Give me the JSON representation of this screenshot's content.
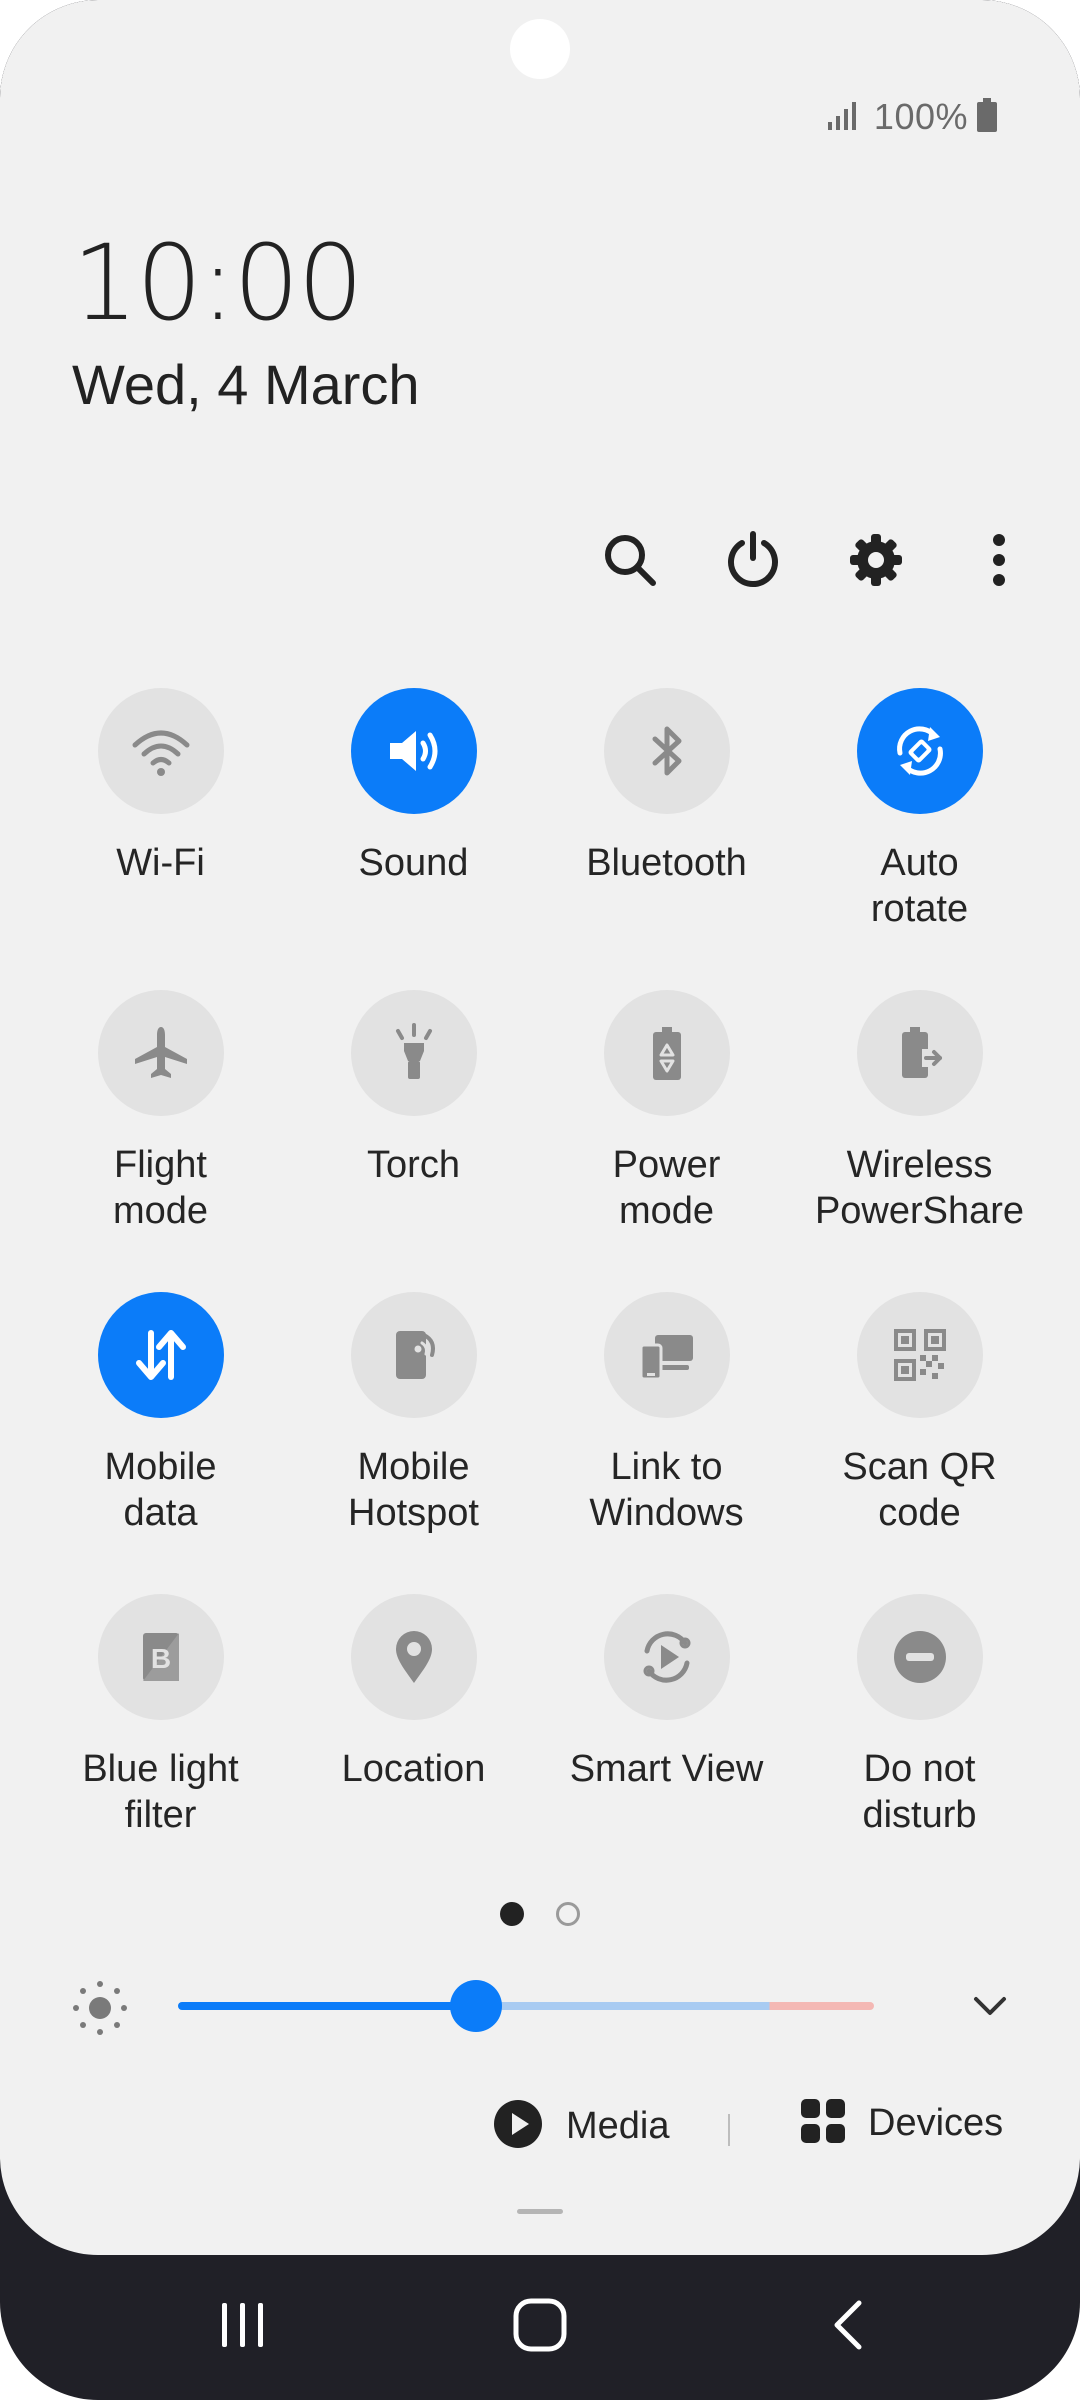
{
  "status": {
    "battery_text": "100%",
    "signal_icon": "signal-icon",
    "battery_icon": "battery-icon"
  },
  "clock": {
    "time": "10:00",
    "date": "Wed, 4 March"
  },
  "actions": [
    "search-icon",
    "power-icon",
    "settings-icon",
    "more-icon"
  ],
  "tiles": [
    {
      "label": "Wi-Fi",
      "icon": "wifi-icon",
      "on": false
    },
    {
      "label": "Sound",
      "icon": "sound-icon",
      "on": true
    },
    {
      "label": "Bluetooth",
      "icon": "bluetooth-icon",
      "on": false
    },
    {
      "label": "Auto\nrotate",
      "icon": "auto-rotate-icon",
      "on": true
    },
    {
      "label": "Flight\nmode",
      "icon": "airplane-icon",
      "on": false
    },
    {
      "label": "Torch",
      "icon": "torch-icon",
      "on": false
    },
    {
      "label": "Power\nmode",
      "icon": "power-mode-icon",
      "on": false
    },
    {
      "label": "Wireless\nPowerShare",
      "icon": "wireless-powershare-icon",
      "on": false
    },
    {
      "label": "Mobile\ndata",
      "icon": "mobile-data-icon",
      "on": true
    },
    {
      "label": "Mobile\nHotspot",
      "icon": "hotspot-icon",
      "on": false
    },
    {
      "label": "Link to\nWindows",
      "icon": "link-to-windows-icon",
      "on": false
    },
    {
      "label": "Scan QR\ncode",
      "icon": "qr-code-icon",
      "on": false
    },
    {
      "label": "Blue light\nfilter",
      "icon": "blue-light-filter-icon",
      "on": false
    },
    {
      "label": "Location",
      "icon": "location-icon",
      "on": false
    },
    {
      "label": "Smart View",
      "icon": "smart-view-icon",
      "on": false
    },
    {
      "label": "Do not\ndisturb",
      "icon": "do-not-disturb-icon",
      "on": false
    }
  ],
  "pager": {
    "count": 2,
    "active": 0
  },
  "brightness": {
    "level": 0.428
  },
  "media": {
    "label": "Media"
  },
  "devices": {
    "label": "Devices"
  },
  "colors": {
    "accent": "#0b7cf9",
    "panel_bg": "#f1f1f1",
    "tile_off": "#e2e2e2",
    "navbar": "#202027"
  }
}
